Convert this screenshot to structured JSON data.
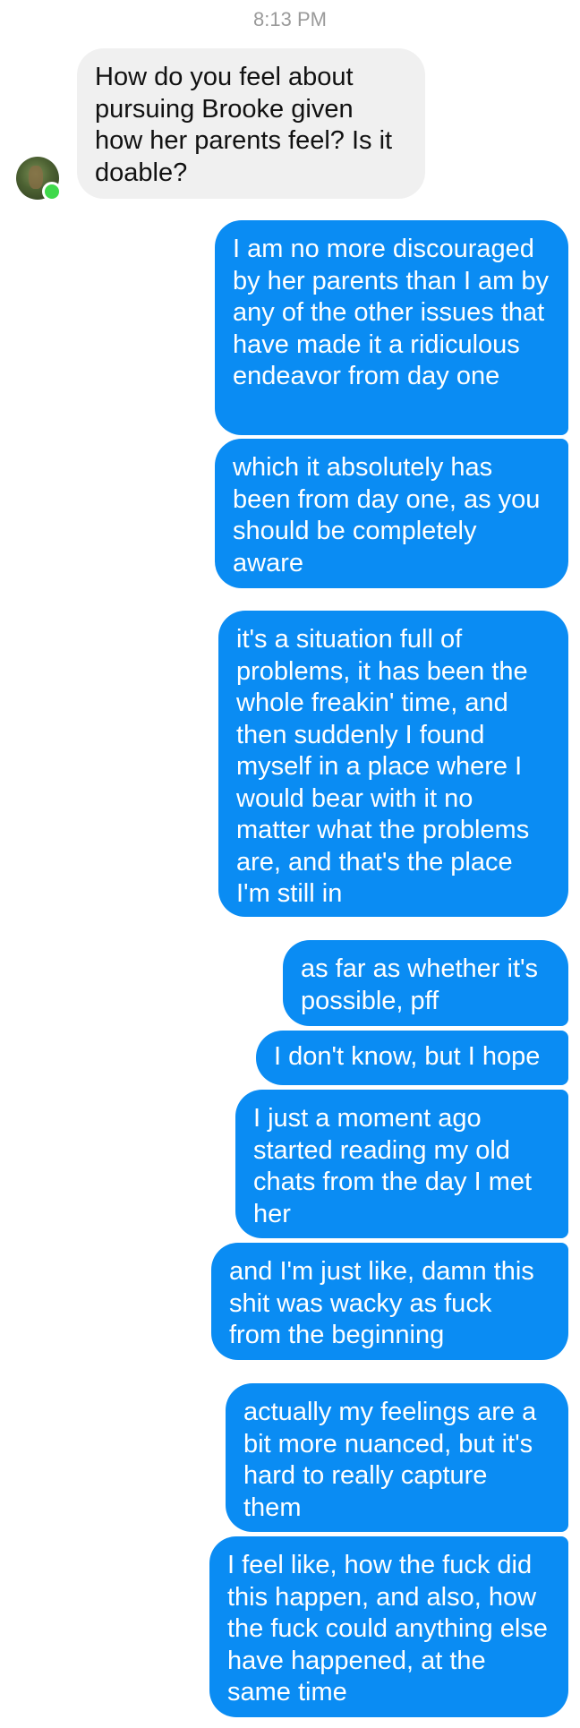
{
  "thread": {
    "timestamp": "8:13 PM"
  },
  "contact": {
    "avatar_icon": "profile-photo",
    "online_color": "#3fd94b"
  },
  "colors": {
    "outgoing_bubble": "#0a8cf3",
    "incoming_bubble": "#f0f0f0"
  },
  "messages": [
    {
      "sender": "them",
      "text": "How do you feel about pursuing Brooke given how her parents feel? Is it doable?"
    },
    {
      "sender": "me",
      "text": "I am no more discouraged by her parents than I am by any of the other issues that have made it a ridiculous endeavor from day one"
    },
    {
      "sender": "me",
      "text": "which it absolutely has been from day one, as you should be completely aware"
    },
    {
      "sender": "me",
      "text": "it's a situation full of problems, it has been the whole freakin' time, and then suddenly I found myself in a place where I would bear with it no matter what the problems are, and that's the place I'm still in"
    },
    {
      "sender": "me",
      "text": "as far as whether it's possible, pff"
    },
    {
      "sender": "me",
      "text": "I don't know, but I hope"
    },
    {
      "sender": "me",
      "text": "I just a moment ago started reading my old chats from the day I met her"
    },
    {
      "sender": "me",
      "text": "and I'm just like, damn this shit was wacky as fuck from the beginning"
    },
    {
      "sender": "me",
      "text": "actually my feelings are a bit more nuanced, but it's hard to really capture them"
    },
    {
      "sender": "me",
      "text": "I feel like, how the fuck did this happen, and also, how the fuck could anything else have happened, at the same time"
    }
  ]
}
